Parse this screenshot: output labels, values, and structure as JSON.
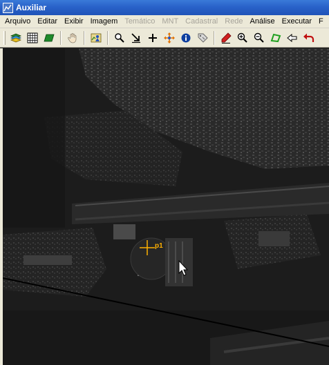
{
  "window": {
    "title": "Auxiliar"
  },
  "menu": {
    "items": [
      {
        "label": "Arquivo",
        "enabled": true
      },
      {
        "label": "Editar",
        "enabled": true
      },
      {
        "label": "Exibir",
        "enabled": true
      },
      {
        "label": "Imagem",
        "enabled": true
      },
      {
        "label": "Temático",
        "enabled": false
      },
      {
        "label": "MNT",
        "enabled": false
      },
      {
        "label": "Cadastral",
        "enabled": false
      },
      {
        "label": "Rede",
        "enabled": false
      },
      {
        "label": "Análise",
        "enabled": true
      },
      {
        "label": "Executar",
        "enabled": true
      },
      {
        "label": "F",
        "enabled": true
      }
    ]
  },
  "toolbar": {
    "buttons": [
      {
        "icon": "layers-icon"
      },
      {
        "icon": "grid-icon"
      },
      {
        "icon": "plane-icon"
      },
      {
        "icon": "hand-icon"
      },
      {
        "icon": "map-person-icon"
      },
      {
        "icon": "zoom-pointer-icon"
      },
      {
        "icon": "arrow-down-right-icon"
      },
      {
        "icon": "cross-icon"
      },
      {
        "icon": "move-icon"
      },
      {
        "icon": "info-icon"
      },
      {
        "icon": "tag-icon"
      },
      {
        "icon": "pencil-icon"
      },
      {
        "icon": "zoom-in-icon"
      },
      {
        "icon": "zoom-out-icon"
      },
      {
        "icon": "polygon-icon"
      },
      {
        "icon": "back-arrow-icon"
      },
      {
        "icon": "undo-icon"
      }
    ]
  },
  "map": {
    "point_label": "p1",
    "marker_color": "#ffb000",
    "line_color": "#000000"
  }
}
